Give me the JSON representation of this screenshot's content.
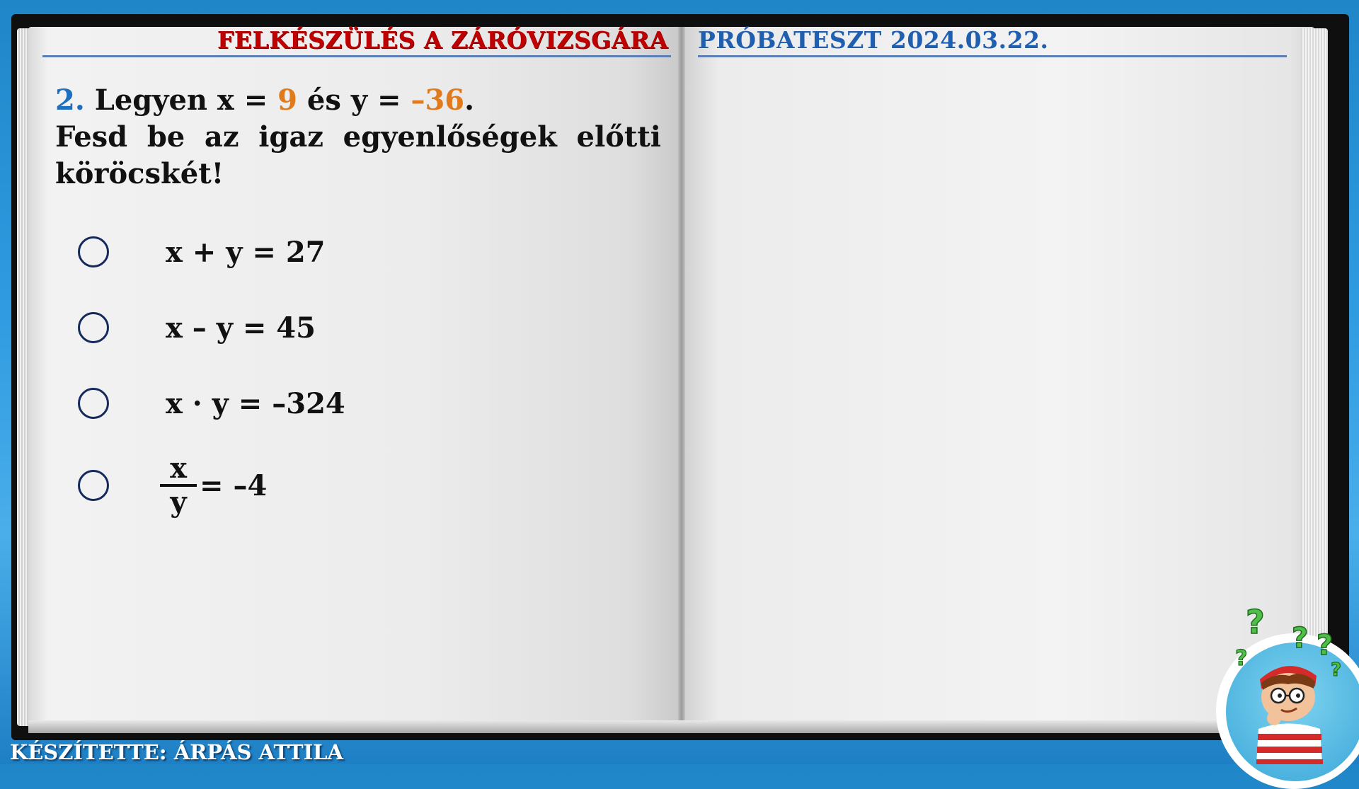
{
  "header": {
    "left_title": "FELKÉSZÜLÉS A ZÁRÓVIZSGÁRA",
    "right_title": "PRÓBATESZT 2024.03.22."
  },
  "question": {
    "number": "2.",
    "line1_a": " Legyen x = ",
    "x_value": "9",
    "line1_b": " és y = ",
    "y_value": "–36",
    "line1_end": ".",
    "instruction": "Fesd be az igaz egyenlőségek előtti köröcskét!"
  },
  "options": [
    {
      "text": "x + y = 27"
    },
    {
      "text": "x – y = 45"
    },
    {
      "text": "x · y = –324"
    },
    {
      "numerator": "x",
      "denominator": "y",
      "rest": "= –4"
    }
  ],
  "footer": {
    "author": "KÉSZÍTETTE: ÁRPÁS ATTILA"
  },
  "colors": {
    "header_red": "#c00000",
    "header_blue": "#1f5fb0",
    "question_number": "#1f6fbf",
    "value_orange": "#e07a1a",
    "circle": "#152a5c"
  },
  "icons": {
    "mascot": "thinking-boy-with-question-marks-icon"
  }
}
